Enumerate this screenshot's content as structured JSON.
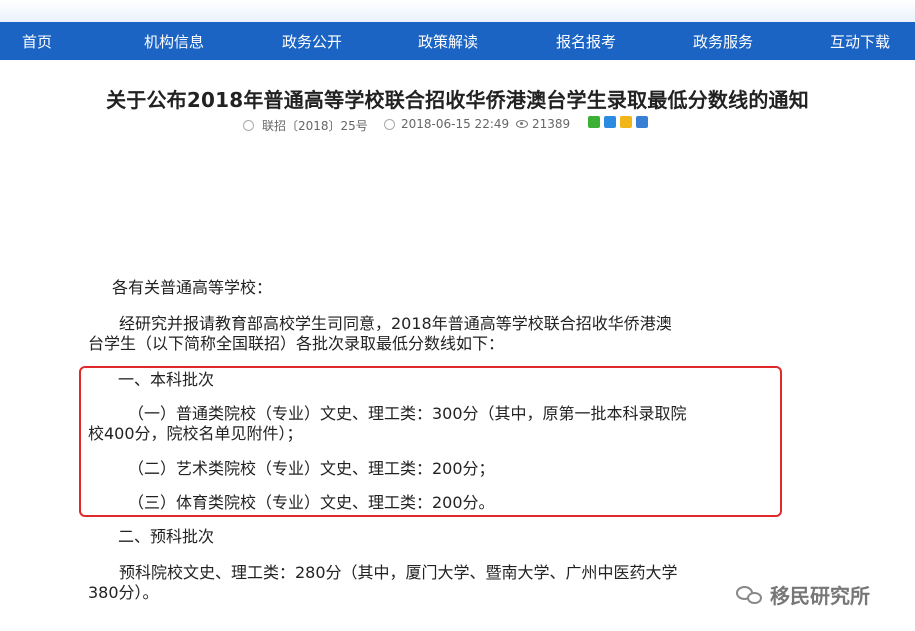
{
  "nav": {
    "items": [
      "首页",
      "机构信息",
      "政务公开",
      "政策解读",
      "报名报考",
      "政务服务",
      "互动下载"
    ]
  },
  "article": {
    "title": "关于公布2018年普通高等学校联合招收华侨港澳台学生录取最低分数线的通知",
    "doc_number": "联招〔2018〕25号",
    "date": "2018-06-15 22:49",
    "views": "21389",
    "greeting": "各有关普通高等学校：",
    "intro_line1": "经研究并报请教育部高校学生司同意，2018年普通高等学校联合招收华侨港澳",
    "intro_line2": "台学生（以下简称全国联招）各批次录取最低分数线如下：",
    "section1_heading": "一、本科批次",
    "item1_line1": "（一）普通类院校（专业）文史、理工类：300分（其中，原第一批本科录取院",
    "item1_line2": "校400分，院校名单见附件）；",
    "item2": "（二）艺术类院校（专业）文史、理工类：200分；",
    "item3": "（三）体育类院校（专业）文史、理工类：200分。",
    "section2_heading": "二、预科批次",
    "prep_line1": "预科院校文史、理工类：280分（其中，厦门大学、暨南大学、广州中医药大学",
    "prep_line2": "380分）。"
  },
  "watermark": {
    "text": "移民研究所"
  },
  "colors": {
    "nav_bg": "#1c64c4",
    "highlight_border": "#e02a2a"
  }
}
